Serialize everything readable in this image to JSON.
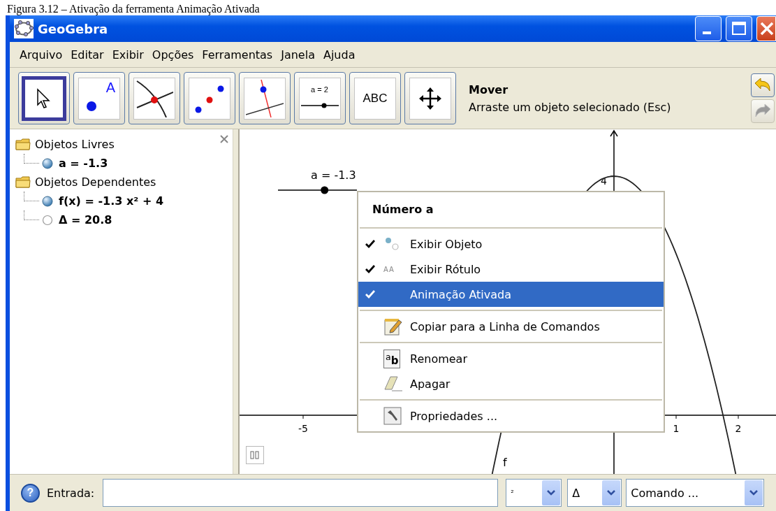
{
  "caption": "Figura 3.12 – Ativação da ferramenta Animação Ativada",
  "window": {
    "title": "GeoGebra"
  },
  "menu_bar": [
    "Arquivo",
    "Editar",
    "Exibir",
    "Opções",
    "Ferramentas",
    "Janela",
    "Ajuda"
  ],
  "toolbar": {
    "tools": [
      {
        "selected": true
      },
      {
        "selected": false,
        "label": "A"
      },
      {
        "selected": false
      },
      {
        "selected": false
      },
      {
        "selected": false
      },
      {
        "selected": false,
        "label": "a = 2"
      },
      {
        "selected": false,
        "label": "ABC"
      },
      {
        "selected": false
      }
    ],
    "mode_title": "Mover",
    "mode_help": "Arraste um objeto selecionado (Esc)",
    "history_buttons": [
      {
        "disabled": false
      },
      {
        "disabled": true
      }
    ]
  },
  "algebra_view": {
    "groups": [
      {
        "label": "Objetos Livres",
        "children": [
          {
            "label": "a = -1.3",
            "visible": true
          }
        ]
      },
      {
        "label": "Objetos Dependentes",
        "children": [
          {
            "label": "f(x) = -1.3 x² + 4",
            "visible": true
          },
          {
            "label": "Δ = 20.8",
            "visible": false
          }
        ]
      }
    ]
  },
  "graphics_view": {
    "slider_label": "a = -1.3",
    "slider": {
      "level": 0.59
    },
    "x_tick_labels": [
      "-5",
      "1",
      "2"
    ],
    "y_tick_labels": [
      "4"
    ],
    "function_label": "f"
  },
  "context_menu": {
    "title": "Número a",
    "groups": [
      [
        {
          "kind": "check",
          "label": "Exibir Objeto",
          "checked": true,
          "selected": false
        },
        {
          "kind": "check",
          "label": "Exibir Rótulo",
          "checked": true,
          "selected": false,
          "icon_text": "AA"
        },
        {
          "kind": "check",
          "label": "Animação Ativada",
          "checked": true,
          "selected": true
        }
      ],
      [
        {
          "kind": "command",
          "label": "Copiar para a Linha de Comandos",
          "selected": false
        }
      ],
      [
        {
          "kind": "command",
          "label": "Renomear",
          "selected": false,
          "icon_text": "$^{a}$**b**"
        },
        {
          "kind": "command",
          "label": "Apagar",
          "selected": false
        }
      ],
      [
        {
          "kind": "command",
          "label": "Propriedades ...",
          "selected": false
        }
      ]
    ]
  },
  "input_bar": {
    "help": "?",
    "label": "Entrada:",
    "dropdowns": [
      "²",
      "Δ",
      "Comando ..."
    ]
  }
}
